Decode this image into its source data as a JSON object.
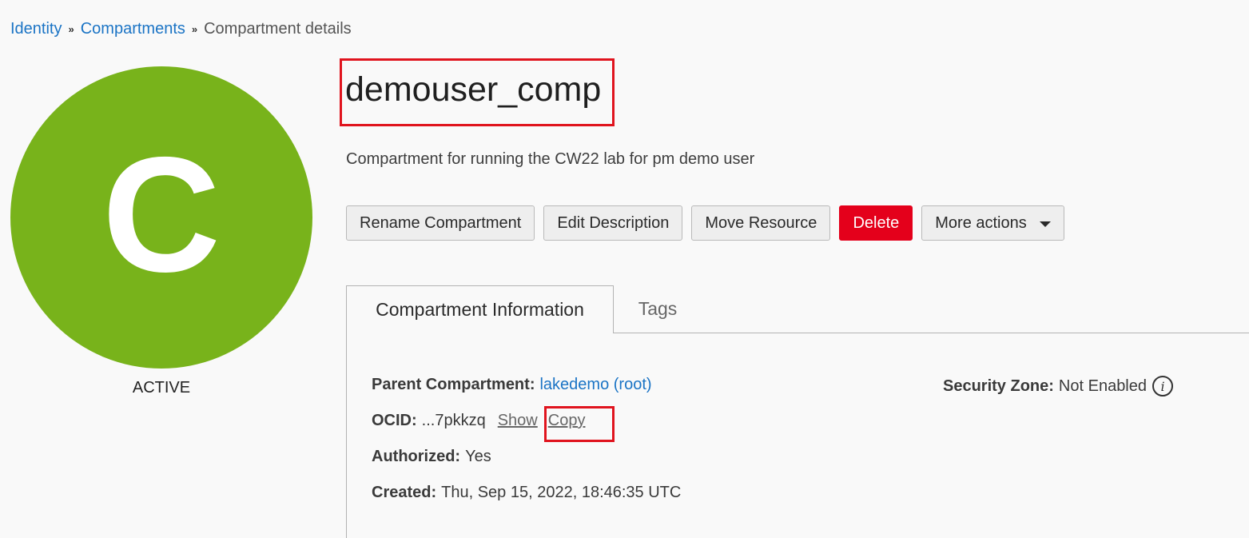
{
  "breadcrumb": {
    "items": [
      "Identity",
      "Compartments"
    ],
    "current": "Compartment details",
    "separator": "»"
  },
  "avatar": {
    "letter": "C",
    "color": "#78b31b",
    "status": "ACTIVE"
  },
  "header": {
    "title": "demouser_comp",
    "description": "Compartment for running the CW22 lab for pm demo user"
  },
  "actions": {
    "rename": "Rename Compartment",
    "edit_description": "Edit Description",
    "move_resource": "Move Resource",
    "delete": "Delete",
    "more_actions": "More actions",
    "danger_color": "#e4001b"
  },
  "tabs": {
    "info": "Compartment Information",
    "tags": "Tags",
    "active": "Compartment Information"
  },
  "info": {
    "parent_label": "Parent Compartment:",
    "parent_value": "lakedemo (root)",
    "ocid_label": "OCID:",
    "ocid_value": "...7pkkzq",
    "ocid_show": "Show",
    "ocid_copy": "Copy",
    "authorized_label": "Authorized:",
    "authorized_value": "Yes",
    "created_label": "Created:",
    "created_value": "Thu, Sep 15, 2022, 18:46:35 UTC",
    "security_zone_label": "Security Zone:",
    "security_zone_value": "Not Enabled",
    "info_icon": "info-icon"
  },
  "highlight_color": "#e0141e"
}
